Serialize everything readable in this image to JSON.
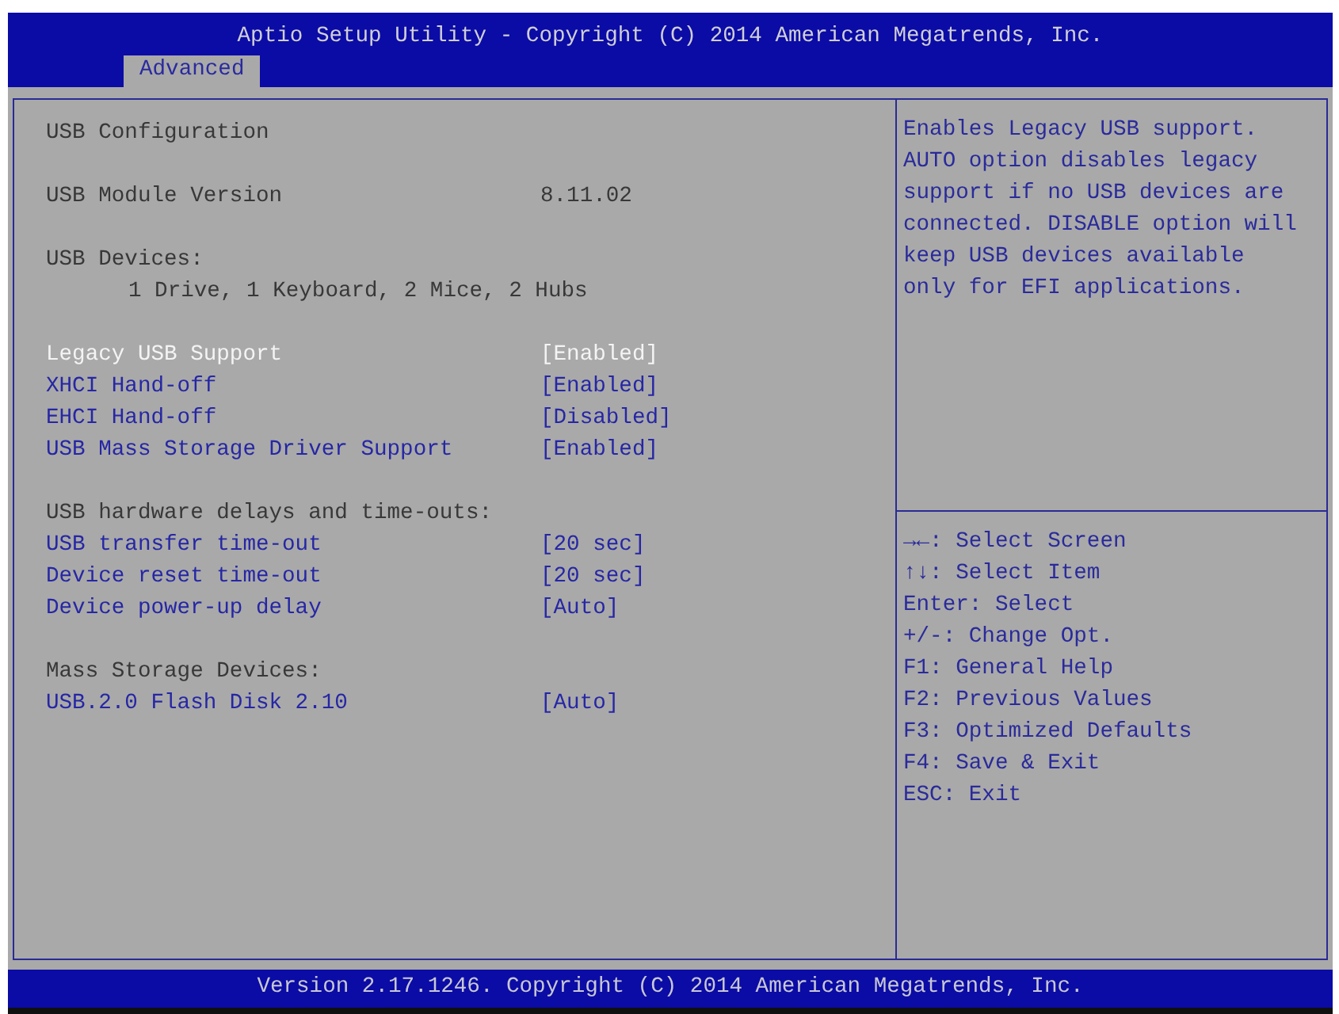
{
  "header": {
    "title": "Aptio Setup Utility - Copyright (C) 2014 American Megatrends, Inc.",
    "tabs": [
      {
        "label": "Advanced",
        "selected": true
      }
    ]
  },
  "settings": {
    "groups": [
      {
        "items": [
          {
            "kind": "heading",
            "text": "USB Configuration"
          }
        ]
      },
      {
        "items": [
          {
            "kind": "info",
            "label": "USB Module Version",
            "value": "8.11.02"
          }
        ]
      },
      {
        "items": [
          {
            "kind": "heading",
            "text": "USB Devices:"
          },
          {
            "kind": "detail",
            "text": "1 Drive, 1 Keyboard, 2 Mice, 2 Hubs"
          }
        ]
      },
      {
        "items": [
          {
            "kind": "setting",
            "label": "Legacy USB Support",
            "value": "[Enabled]",
            "selected": true
          },
          {
            "kind": "setting",
            "label": "XHCI Hand-off",
            "value": "[Enabled]",
            "selected": false
          },
          {
            "kind": "setting",
            "label": "EHCI Hand-off",
            "value": "[Disabled]",
            "selected": false
          },
          {
            "kind": "setting",
            "label": "USB Mass Storage Driver Support",
            "value": "[Enabled]",
            "selected": false
          }
        ]
      },
      {
        "items": [
          {
            "kind": "heading",
            "text": "USB hardware delays and time-outs:"
          },
          {
            "kind": "setting",
            "label": "USB transfer time-out",
            "value": "[20 sec]",
            "selected": false
          },
          {
            "kind": "setting",
            "label": "Device reset time-out",
            "value": "[20 sec]",
            "selected": false
          },
          {
            "kind": "setting",
            "label": "Device power-up delay",
            "value": "[Auto]",
            "selected": false
          }
        ]
      },
      {
        "items": [
          {
            "kind": "heading",
            "text": "Mass Storage Devices:"
          },
          {
            "kind": "setting",
            "label": "USB.2.0 Flash Disk 2.10",
            "value": "[Auto]",
            "selected": false
          }
        ]
      }
    ]
  },
  "help": {
    "description": "Enables Legacy USB support. AUTO option disables legacy support if no USB devices are connected. DISABLE option will keep USB devices available only for EFI applications.",
    "keys": [
      "→←: Select Screen",
      "↑↓: Select Item",
      "Enter: Select",
      "+/-: Change Opt.",
      "F1: General Help",
      "F2: Previous Values",
      "F3: Optimized Defaults",
      "F4: Save & Exit",
      "ESC: Exit"
    ]
  },
  "status_bar": {
    "text": "Version 2.17.1246. Copyright (C) 2014 American Megatrends, Inc."
  }
}
